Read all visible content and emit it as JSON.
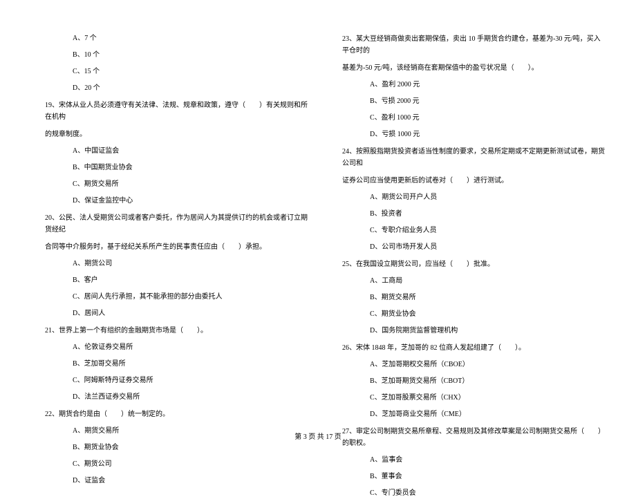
{
  "left": {
    "q18_opts": [
      "A、7 个",
      "B、10 个",
      "C、15 个",
      "D、20 个"
    ],
    "q19": "19、宋体从业人员必须遵守有关法律、法规、规章和政策，遵守（　　）有关规则和所在机构",
    "q19_cont": "的规章制度。",
    "q19_opts": [
      "A、中国证监会",
      "B、中国期货业协会",
      "C、期货交易所",
      "D、保证金监控中心"
    ],
    "q20": "20、公民、法人受期货公司或者客户委托，作为居间人为其提供订约的机会或者订立期货经纪",
    "q20_cont": "合同等中介服务时，基于经纪关系所产生的民事责任应由（　　）承担。",
    "q20_opts": [
      "A、期货公司",
      "B、客户",
      "C、居间人先行承担，其不能承担的部分由委托人",
      "D、居间人"
    ],
    "q21": "21、世界上第一个有组织的金融期货市场是（　　）。",
    "q21_opts": [
      "A、伦敦证券交易所",
      "B、芝加哥交易所",
      "C、阿姆斯特丹证券交易所",
      "D、法兰西证券交易所"
    ],
    "q22": "22、期货合约是由（　　）统一制定的。",
    "q22_opts": [
      "A、期货交易所",
      "B、期货业协会",
      "C、期货公司",
      "D、证监会"
    ]
  },
  "right": {
    "q23": "23、某大豆经销商做卖出套期保值，卖出 10 手期货合约建仓，基差为-30 元/吨，买入平仓时的",
    "q23_cont": "基差为-50 元/吨，该经销商在套期保值中的盈亏状况是（　　）。",
    "q23_opts": [
      "A、盈利 2000 元",
      "B、亏损 2000 元",
      "C、盈利 1000 元",
      "D、亏损 1000 元"
    ],
    "q24": "24、按照股指期货投资者适当性制度的要求，交易所定期或不定期更新测试试卷，期货公司和",
    "q24_cont": "证券公司应当使用更新后的试卷对（　　）进行测试。",
    "q24_opts": [
      "A、期货公司开户人员",
      "B、投资者",
      "C、专职介绍业务人员",
      "D、公司市场开发人员"
    ],
    "q25": "25、在我国设立期货公司，应当经（　　）批准。",
    "q25_opts": [
      "A、工商局",
      "B、期货交易所",
      "C、期货业协会",
      "D、国务院期货监督管理机构"
    ],
    "q26": "26、宋体 1848 年，芝加哥的 82 位商人发起组建了（　　）。",
    "q26_opts": [
      "A、芝加哥期权交易所（CBOE）",
      "B、芝加哥期货交易所（CBOT）",
      "C、芝加哥股票交易所（CHX）",
      "D、芝加哥商业交易所（CME）"
    ],
    "q27": "27、审定公司制期货交易所章程、交易规则及其修改草案是公司制期货交易所（　　）的职权。",
    "q27_opts": [
      "A、监事会",
      "B、董事会",
      "C、专门委员会"
    ]
  },
  "footer": "第 3 页 共 17 页"
}
